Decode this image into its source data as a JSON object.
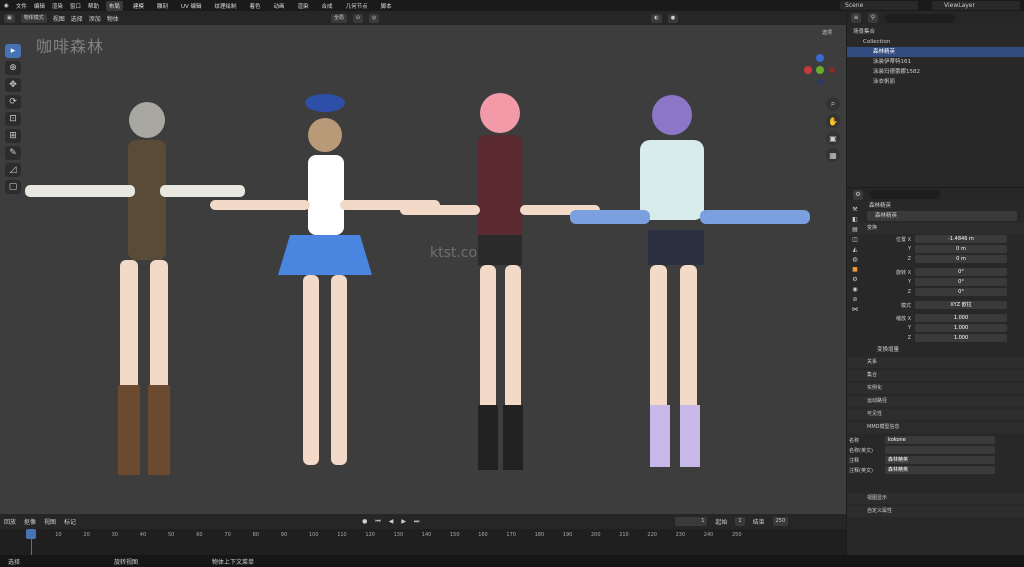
{
  "menu": [
    "文件",
    "编辑",
    "渲染",
    "窗口",
    "帮助"
  ],
  "workspaces": [
    {
      "label": "布局",
      "active": true
    },
    {
      "label": "建模"
    },
    {
      "label": "雕刻"
    },
    {
      "label": "UV 编辑"
    },
    {
      "label": "纹理绘制"
    },
    {
      "label": "着色"
    },
    {
      "label": "动画"
    },
    {
      "label": "渲染"
    },
    {
      "label": "合成"
    },
    {
      "label": "几何节点"
    },
    {
      "label": "脚本"
    }
  ],
  "scene": "Scene",
  "view_layer": "ViewLayer",
  "viewport_header": {
    "mode": "物体模式",
    "menus": [
      "视图",
      "选择",
      "添加",
      "物体"
    ],
    "transform": "全局",
    "options": "选项"
  },
  "watermark_top": "咖啡森林",
  "watermark_mid": "ktst.com",
  "outliner": {
    "root": "场景集合",
    "collection": "Collection",
    "items": [
      {
        "name": "森林精英",
        "selected": true
      },
      {
        "name": "泳装伊蒂特161"
      },
      {
        "name": "泳装玛德蕾娜1582"
      },
      {
        "name": "泳衣帆丽"
      }
    ]
  },
  "properties": {
    "object_name": "森林精英",
    "data_name": "森林精英",
    "transform_panel": "变换",
    "location": {
      "label_x": "位置 X",
      "x": "-1.4846 m",
      "y": "0 m",
      "z": "0 m"
    },
    "rotation": {
      "label_x": "旋转 X",
      "x": "0°",
      "y": "0°",
      "z": "0°"
    },
    "mode_label": "模式",
    "mode": "XYZ 欧拉",
    "scale": {
      "label_x": "缩放 X",
      "x": "1.000",
      "y": "1.000",
      "z": "1.000"
    },
    "delta": "变换增量",
    "panels": [
      "关系",
      "集合",
      "实例化",
      "运动路径",
      "可见性",
      "MMD模型信息"
    ],
    "mmd": {
      "name_label": "名称",
      "name": "kokone",
      "name_en_label": "名称(英文)",
      "comment_label": "注释",
      "comment": "森林精英",
      "comment_en_label": "注释(英文)",
      "comment_en": "森林精英"
    },
    "bottom_panels": [
      "视图显示",
      "自定义属性"
    ]
  },
  "timeline": {
    "menus": [
      "回放",
      "抠像",
      "视图",
      "标记"
    ],
    "current_frame": "1",
    "start_label": "起始",
    "start": "1",
    "end_label": "结束",
    "end": "250",
    "ticks": [
      "1",
      "10",
      "20",
      "30",
      "40",
      "50",
      "60",
      "70",
      "80",
      "90",
      "100",
      "110",
      "120",
      "130",
      "140",
      "150",
      "160",
      "170",
      "180",
      "190",
      "200",
      "210",
      "220",
      "230",
      "240",
      "250"
    ]
  },
  "status": [
    "选择",
    "旋转视图",
    "物体上下文菜单"
  ],
  "colors": {
    "accent": "#4772b3",
    "selected_row": "#334d80",
    "viewport_bg": "#3d3d3d"
  }
}
